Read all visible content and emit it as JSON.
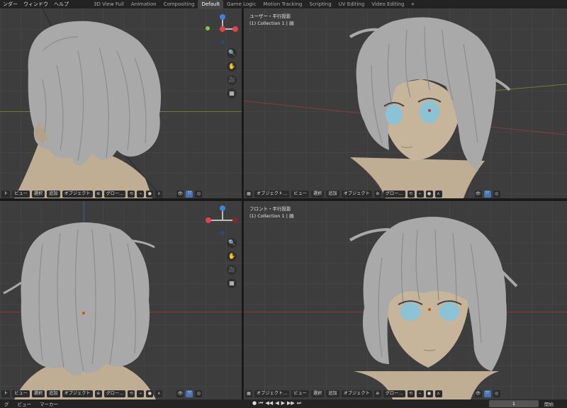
{
  "topbar": {
    "menus": [
      "ンダー",
      "ウィンドウ",
      "ヘルプ"
    ],
    "workspaces": [
      "3D View Full",
      "Animation",
      "Compositing",
      "Default",
      "Game Logic",
      "Motion Tracking",
      "Scripting",
      "UV Editing",
      "Video Editing"
    ],
    "active_workspace": "Default",
    "add_tab": "+"
  },
  "viewport_tl": {
    "footer": {
      "mode_prefix": "ト",
      "view": "ビュー",
      "select": "選択",
      "add": "追加",
      "object": "オブジェクト",
      "transform": "グロー…",
      "shading": "▾"
    }
  },
  "viewport_tr": {
    "view_name": "ユーザー・平行投影",
    "collection": "(1) Collection 1 | 顔",
    "footer": {
      "mode": "オブジェクト…",
      "view": "ビュー",
      "select": "選択",
      "add": "追加",
      "object": "オブジェクト",
      "transform": "グロー…"
    }
  },
  "viewport_bl": {
    "footer": {
      "mode_prefix": "ト",
      "view": "ビュー",
      "select": "選択",
      "add": "追加",
      "object": "オブジェクト",
      "transform": "グロー…"
    }
  },
  "viewport_br": {
    "view_name": "フロント・平行投影",
    "collection": "(1) Collection 1 | 顔",
    "footer": {
      "mode": "オブジェクト…",
      "view": "ビュー",
      "select": "選択",
      "add": "追加",
      "object": "オブジェクト",
      "transform": "グロー…"
    }
  },
  "timeline": {
    "menus": [
      "グ",
      "ビュー",
      "マーカー"
    ],
    "playback": [
      "●",
      "⏮",
      "◀◀",
      "◀",
      "▶",
      "▶▶",
      "⏭"
    ],
    "current_frame": "1",
    "start_label": "開始"
  },
  "colors": {
    "viewport_bg": "#3d3d3d",
    "hair": "#a9a9a9",
    "skin": "#bfae93",
    "eye": "#8bc2d6",
    "x_axis": "#e0424f",
    "y_axis": "#8bc43f",
    "z_axis": "#3d82e0",
    "accent": "#4772b3"
  }
}
